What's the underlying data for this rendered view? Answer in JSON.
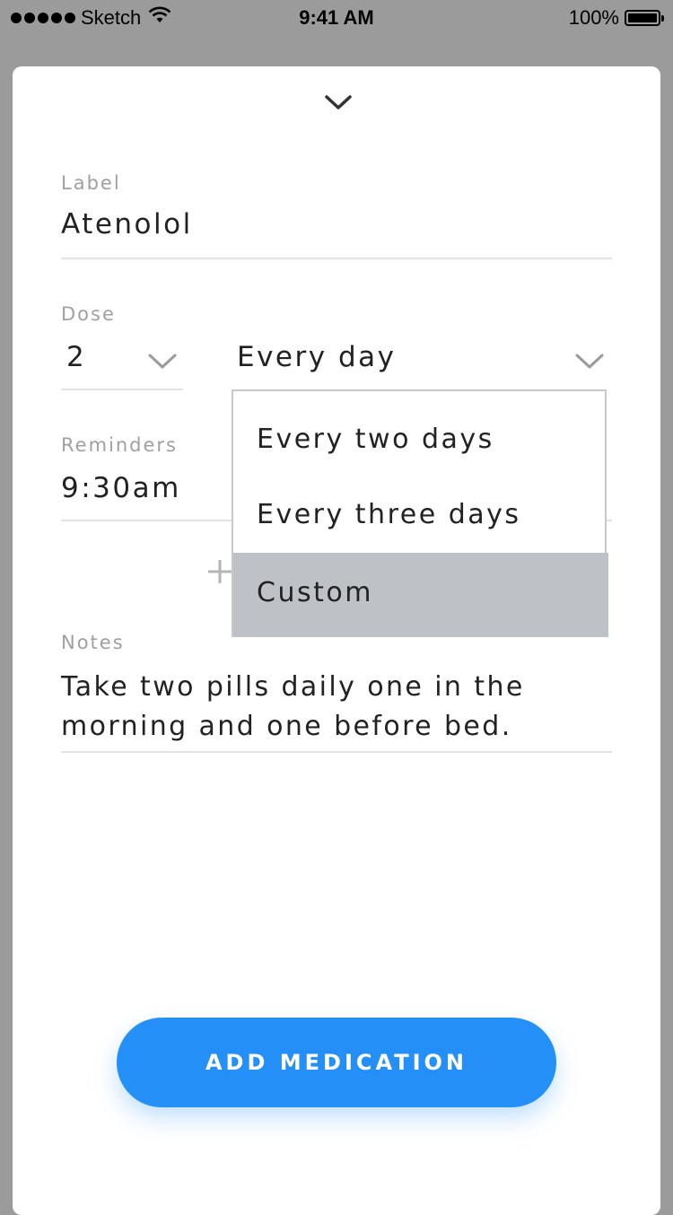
{
  "status_bar": {
    "carrier": "Sketch",
    "time": "9:41 AM",
    "battery": "100%"
  },
  "form": {
    "label_field": {
      "label": "Label",
      "value": "Atenolol"
    },
    "dose_field": {
      "label": "Dose",
      "quantity": "2",
      "frequency": "Every day"
    },
    "reminders_field": {
      "label": "Reminders",
      "value": "9:30am"
    },
    "notes_field": {
      "label": "Notes",
      "value": "Take two pills daily one in the morning and one before bed."
    }
  },
  "frequency_menu": {
    "options": [
      "Every two days",
      "Every three days",
      "Custom"
    ],
    "highlighted": "Custom"
  },
  "actions": {
    "add_label": "ADD MEDICATION"
  },
  "colors": {
    "accent": "#2490f7",
    "background": "#9b9b9b",
    "menu_highlight": "#bec2c6"
  }
}
